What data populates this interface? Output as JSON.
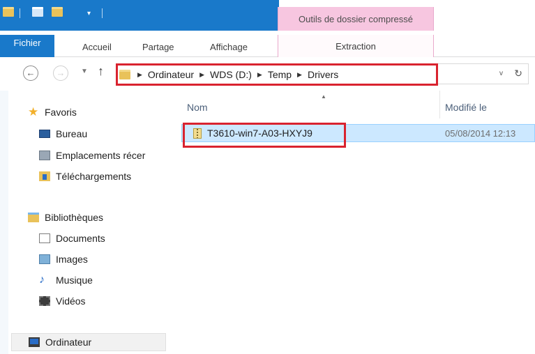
{
  "ribbon": {
    "context_group_title": "Outils de dossier compressé",
    "tabs": [
      {
        "label": "Fichier"
      },
      {
        "label": "Accueil"
      },
      {
        "label": "Partage"
      },
      {
        "label": "Affichage"
      },
      {
        "label": "Extraction"
      }
    ]
  },
  "address_bar": {
    "crumbs": [
      "Ordinateur",
      "WDS (D:)",
      "Temp",
      "Drivers"
    ]
  },
  "nav_pane": {
    "favorites": {
      "label": "Favoris",
      "items": [
        "Bureau",
        "Emplacements récer",
        "Téléchargements"
      ]
    },
    "libraries": {
      "label": "Bibliothèques",
      "items": [
        "Documents",
        "Images",
        "Musique",
        "Vidéos"
      ]
    },
    "computer": {
      "label": "Ordinateur"
    }
  },
  "file_list": {
    "columns": {
      "name": "Nom",
      "modified": "Modifié le"
    },
    "rows": [
      {
        "name": "T3610-win7-A03-HXYJ9",
        "modified": "05/08/2014 12:13"
      }
    ]
  },
  "colors": {
    "accent": "#1979ca",
    "context_tab": "#f7c6e0",
    "selection": "#cce8ff",
    "annotation": "#d9232f"
  }
}
